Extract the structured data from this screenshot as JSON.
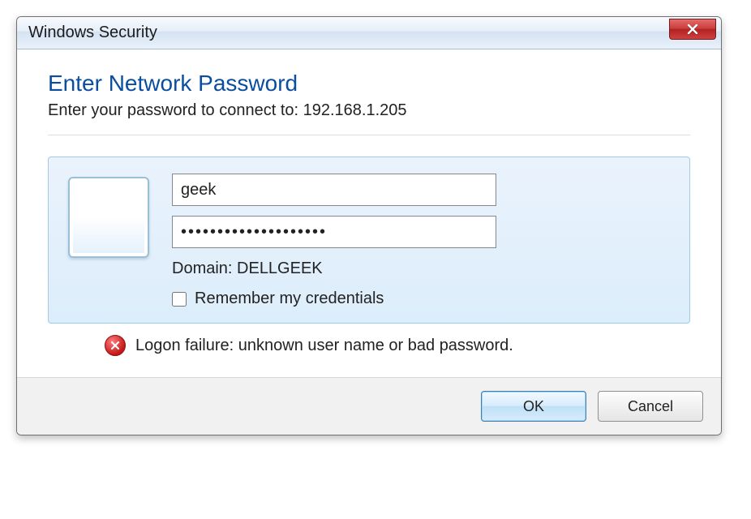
{
  "window": {
    "title": "Windows Security"
  },
  "dialog": {
    "heading": "Enter Network Password",
    "subtext": "Enter your password to connect to: 192.168.1.205"
  },
  "credentials": {
    "username_value": "geek",
    "password_value": "••••••••••••••••••••",
    "domain_label": "Domain: DELLGEEK",
    "remember_label": "Remember my credentials",
    "remember_checked": false
  },
  "error": {
    "message": "Logon failure: unknown user name or bad password."
  },
  "buttons": {
    "ok_label": "OK",
    "cancel_label": "Cancel"
  }
}
